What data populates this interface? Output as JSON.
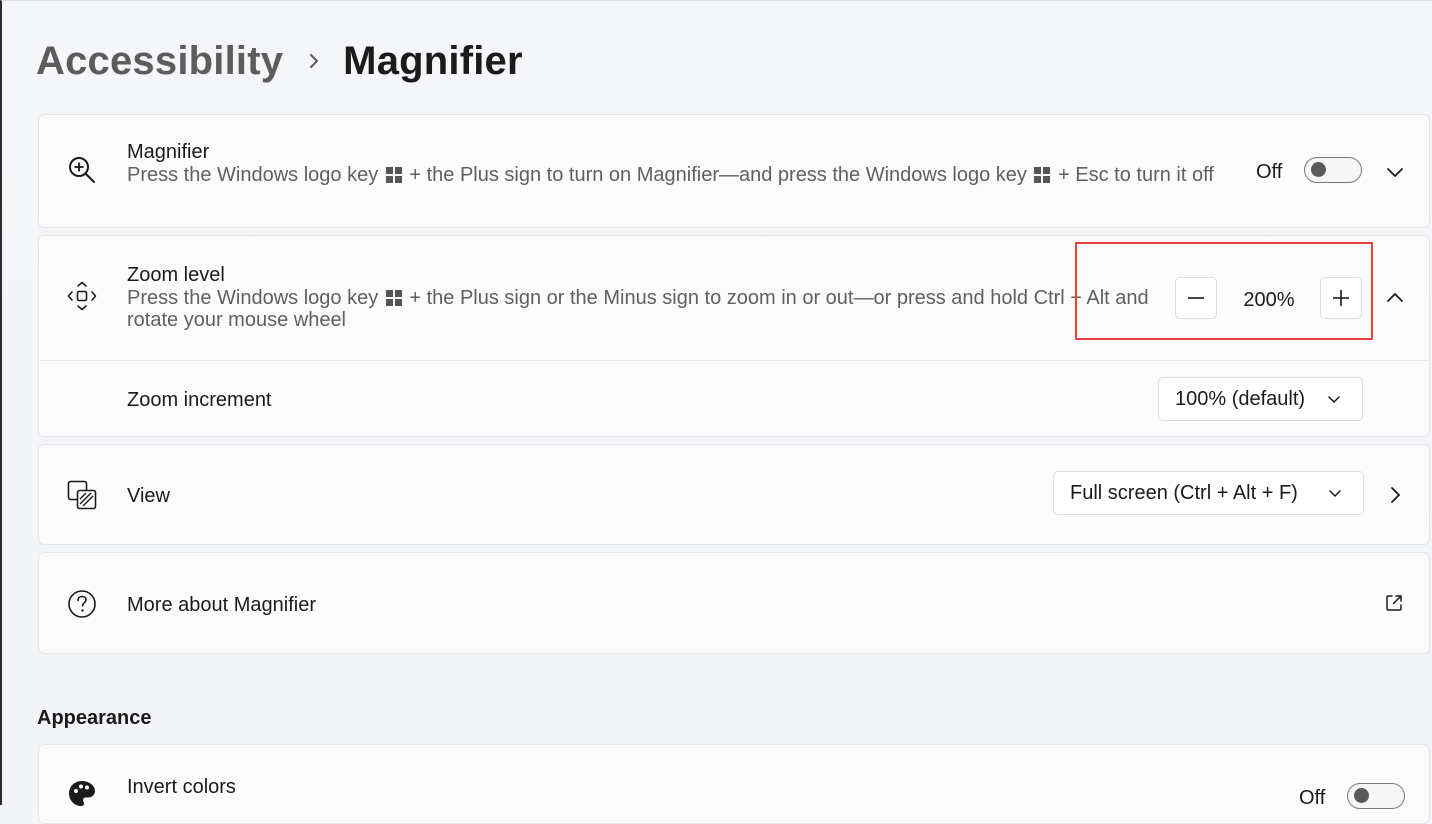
{
  "breadcrumb": {
    "parent": "Accessibility",
    "current": "Magnifier"
  },
  "magnifier": {
    "title": "Magnifier",
    "desc_part1": "Press the Windows logo key",
    "desc_part2": "+ the Plus sign to turn on Magnifier—and press the Windows logo key",
    "desc_part3": "+ Esc to turn it off",
    "toggle_state": "Off"
  },
  "zoom_level": {
    "title": "Zoom level",
    "desc_part1": "Press the Windows logo key",
    "desc_part2": "+ the Plus sign or the Minus sign to zoom in or out—or press and hold Ctrl + Alt and rotate your mouse wheel",
    "value": "200%"
  },
  "zoom_increment": {
    "label": "Zoom increment",
    "selected": "100% (default)"
  },
  "view": {
    "label": "View",
    "selected": "Full screen (Ctrl + Alt + F)"
  },
  "more_about": {
    "label": "More about Magnifier"
  },
  "appearance": {
    "header": "Appearance",
    "invert_colors": {
      "title": "Invert colors",
      "toggle_state": "Off"
    }
  },
  "colors": {
    "highlight": "#e8403a",
    "card_background": "#fbfbfc",
    "page_background": "#f3f5f8"
  }
}
